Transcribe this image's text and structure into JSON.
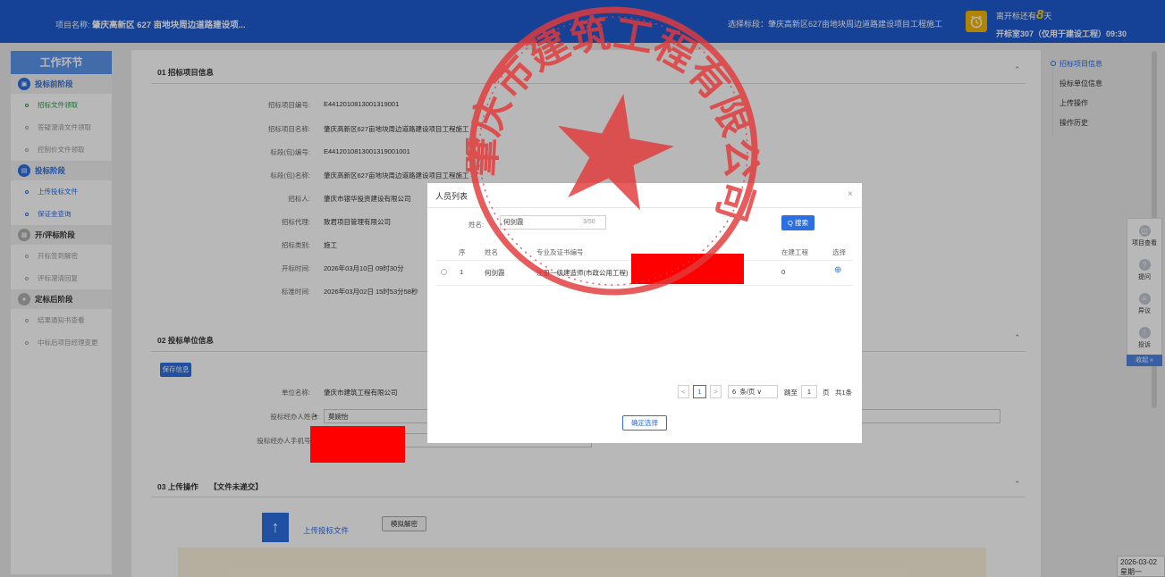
{
  "header": {
    "project_label": "项目名称:",
    "project_name": "肇庆高新区 627 亩地块周边道路建设项...",
    "bid_section": "选择标段：肇庆高新区627亩地块周边道路建设项目工程施工",
    "countdown_prefix": "离开标还有",
    "countdown_value": "8",
    "countdown_suffix": "天",
    "room": "开标室307（仅用于建设工程）09:30",
    "clock_icon": "alarm-clock-icon"
  },
  "sidebar": {
    "title": "工作环节",
    "stages": [
      {
        "label": "投标前阶段",
        "items": [
          "招标文件领取",
          "答疑澄清文件领取",
          "控制价文件领取"
        ]
      },
      {
        "label": "投标阶段",
        "items": [
          "上传投标文件",
          "保证金查询"
        ]
      },
      {
        "label": "开/评标阶段",
        "items": [
          "开标签到解密",
          "评标澄清回复"
        ]
      },
      {
        "label": "定标后阶段",
        "items": [
          "结果通知书查看",
          "中标后项目经理变更"
        ]
      }
    ]
  },
  "section1": {
    "title": "01  招标项目信息",
    "fields": [
      {
        "label": "招标项目编号:",
        "value": "E4412010813001319001"
      },
      {
        "label": "招标项目名称:",
        "value": "肇庆高新区627亩地块周边道路建设项目工程施工"
      },
      {
        "label": "标段(包)编号:",
        "value": "E4412010813001319001001"
      },
      {
        "label": "标段(包)名称:",
        "value": "肇庆高新区627亩地块周边道路建设项目工程施工"
      },
      {
        "label": "招标人:",
        "value": "肇庆市银华投资建设有限公司"
      },
      {
        "label": "招标代理:",
        "value": "致君项目管理有限公司"
      },
      {
        "label": "招标类别:",
        "value": "施工"
      },
      {
        "label": "开标时间:",
        "value": "2026年03月10日 09时30分"
      },
      {
        "label": "标准时间:",
        "value": "2026年03月02日 15时53分58秒"
      }
    ]
  },
  "section2": {
    "title": "02  投标单位信息",
    "save_label": "保存信息",
    "company_label": "单位名称:",
    "company_value": "肇庆市建筑工程有限公司",
    "agent_name_label": "投标经办人姓名:",
    "agent_name_value": "莫婉怡",
    "agent_phone_label": "投标经办人手机号码:"
  },
  "section3": {
    "title": "03  上传操作",
    "status": "【文件未递交】",
    "upload_label": "上传投标文件",
    "simulate_label": "模拟解密"
  },
  "anchor_nav": [
    "招标项目信息",
    "投标单位信息",
    "上传操作",
    "操作历史"
  ],
  "right_tools": [
    {
      "label": "项目查看",
      "icon": "document-search-icon"
    },
    {
      "label": "提问",
      "icon": "question-icon"
    },
    {
      "label": "异议",
      "icon": "objection-icon"
    },
    {
      "label": "投诉",
      "icon": "shield-icon"
    }
  ],
  "collapse_label": "收起 »",
  "datebox": {
    "date": "2026-03-02",
    "weekday": "星期一"
  },
  "modal": {
    "title": "人员列表",
    "close": "×",
    "name_label": "姓名:",
    "name_value": "何剑霞",
    "name_count": "3/50",
    "search_label": "Q 搜索",
    "columns": [
      "序",
      "姓名",
      "专业及证书编号",
      "在建工程",
      "选择"
    ],
    "rows": [
      {
        "index": "1",
        "name": "何剑霞",
        "cert": "注册一级建造师(市政公用工程)",
        "ongoing": "0",
        "select": "⊕"
      }
    ],
    "pager": {
      "prev": "<",
      "page": "1",
      "next": ">",
      "size": "6",
      "size_unit": "条/页 ∨",
      "goto_label": "跳至",
      "goto_value": "1",
      "page_unit": "页",
      "total": "共1条"
    },
    "confirm_label": "确定选择"
  },
  "stamp": {
    "text": "肇庆市建筑工程有限公司",
    "color": "#e23a3a"
  },
  "colors": {
    "primary": "#2b6fe0",
    "header": "#1e5bd0",
    "redaction": "#ff0000"
  }
}
